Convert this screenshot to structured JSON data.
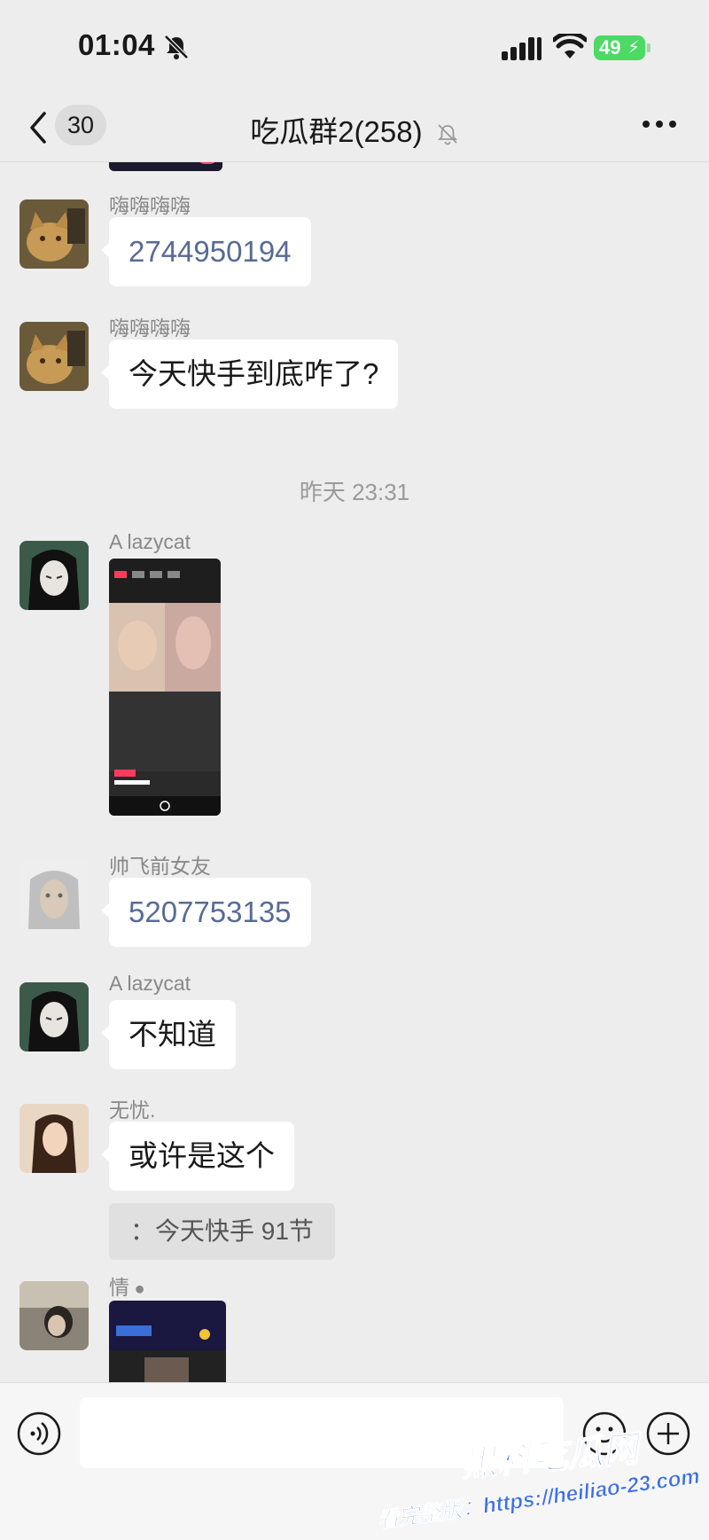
{
  "status_bar": {
    "time": "01:04",
    "battery": "49"
  },
  "nav": {
    "unread_count": "30",
    "title": "吃瓜群2(258)"
  },
  "messages": [
    {
      "type": "timestamp"
    },
    {
      "sender": "嗨嗨嗨嗨",
      "text": "2744950194"
    },
    {
      "sender": "嗨嗨嗨嗨",
      "text": "今天快手到底咋了?"
    },
    {
      "time": "昨天 23:31"
    },
    {
      "sender": "A lazycat"
    },
    {
      "sender": "帅飞前女友",
      "text": "5207753135"
    },
    {
      "sender": "A lazycat",
      "text": "不知道"
    },
    {
      "sender": "无忧.",
      "text": "或许是这个",
      "quote": "：今天快手 91节"
    },
    {
      "sender": "情"
    }
  ],
  "input": {
    "placeholder": ""
  },
  "watermark": {
    "title": "黑料吃瓜网",
    "subtitle": "看完整版：https://heiliao-23.com"
  },
  "colors": {
    "background": "#ededed",
    "bubble": "#ffffff",
    "link_number": "#576b95",
    "battery": "#4cd964"
  }
}
